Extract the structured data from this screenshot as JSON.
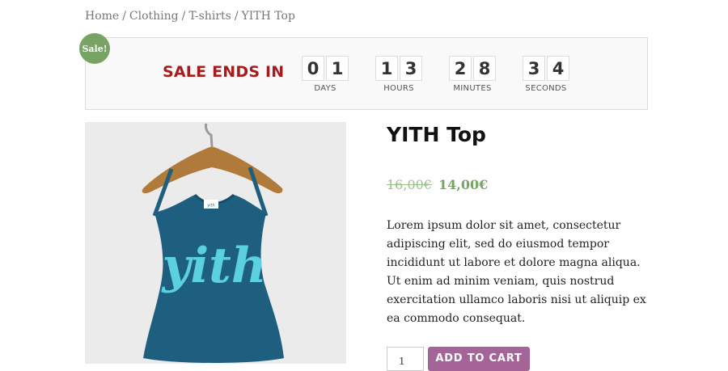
{
  "breadcrumb": {
    "items": [
      "Home",
      "Clothing",
      "T-shirts",
      "YITH Top"
    ],
    "separator": "/"
  },
  "countdown": {
    "badge": "Sale!",
    "heading": "SALE ENDS IN",
    "units": [
      {
        "digits": [
          "0",
          "1"
        ],
        "label": "DAYS"
      },
      {
        "digits": [
          "1",
          "3"
        ],
        "label": "HOURS"
      },
      {
        "digits": [
          "2",
          "8"
        ],
        "label": "MINUTES"
      },
      {
        "digits": [
          "3",
          "4"
        ],
        "label": "SECONDS"
      }
    ]
  },
  "product": {
    "title": "YITH Top",
    "old_price": "16,00€",
    "new_price": "14,00€",
    "description": "Lorem ipsum dolor sit amet, consectetur adipiscing elit, sed do eiusmod tempor incididunt ut labore et dolore magna aliqua. Ut enim ad minim veniam, quis nostrud exercitation ullamco laboris nisi ut aliquip ex ea commodo consequat.",
    "image_print_text": "yith",
    "tag_text": "yith"
  },
  "cart": {
    "quantity": "1",
    "button_label": "ADD TO CART"
  },
  "colors": {
    "sale_badge": "#77a464",
    "sale_heading": "#a61c1c",
    "price": "#77a464",
    "button": "#a46497",
    "shirt": "#1e5f80",
    "print": "#5ad0e0"
  }
}
